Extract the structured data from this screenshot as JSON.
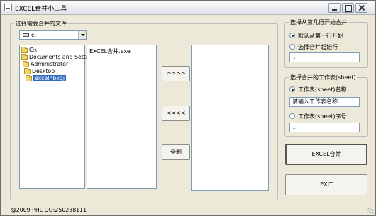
{
  "window": {
    "title": "EXCEL合并小工具"
  },
  "left_group": {
    "title": "选择需要合并的文件",
    "drive": "c:",
    "tree": [
      "C:\\",
      "Documents and Settings",
      "Administrator",
      "Desktop",
      "excelhbxgj"
    ],
    "files": [
      "EXCEL合并.exe"
    ],
    "buttons": {
      "add": ">>>>",
      "remove": "<<<<",
      "delete_all": "全删"
    }
  },
  "row_group": {
    "title": "选择从第几行开始合并",
    "option_default": "默认从第一行开始",
    "option_custom": "选择合并起始行",
    "start_row_value": "1"
  },
  "sheet_group": {
    "title": "选择合并的工作表(sheet)",
    "option_name": "工作表(sheet)名称",
    "sheet_name_value": "请输入工作表名称",
    "option_index": "工作表(sheet)序号",
    "sheet_index_value": "1"
  },
  "actions": {
    "merge": "EXCEL合并",
    "exit": "EXIT"
  },
  "status": {
    "text": "@2009 PHL QQ:250238111"
  }
}
